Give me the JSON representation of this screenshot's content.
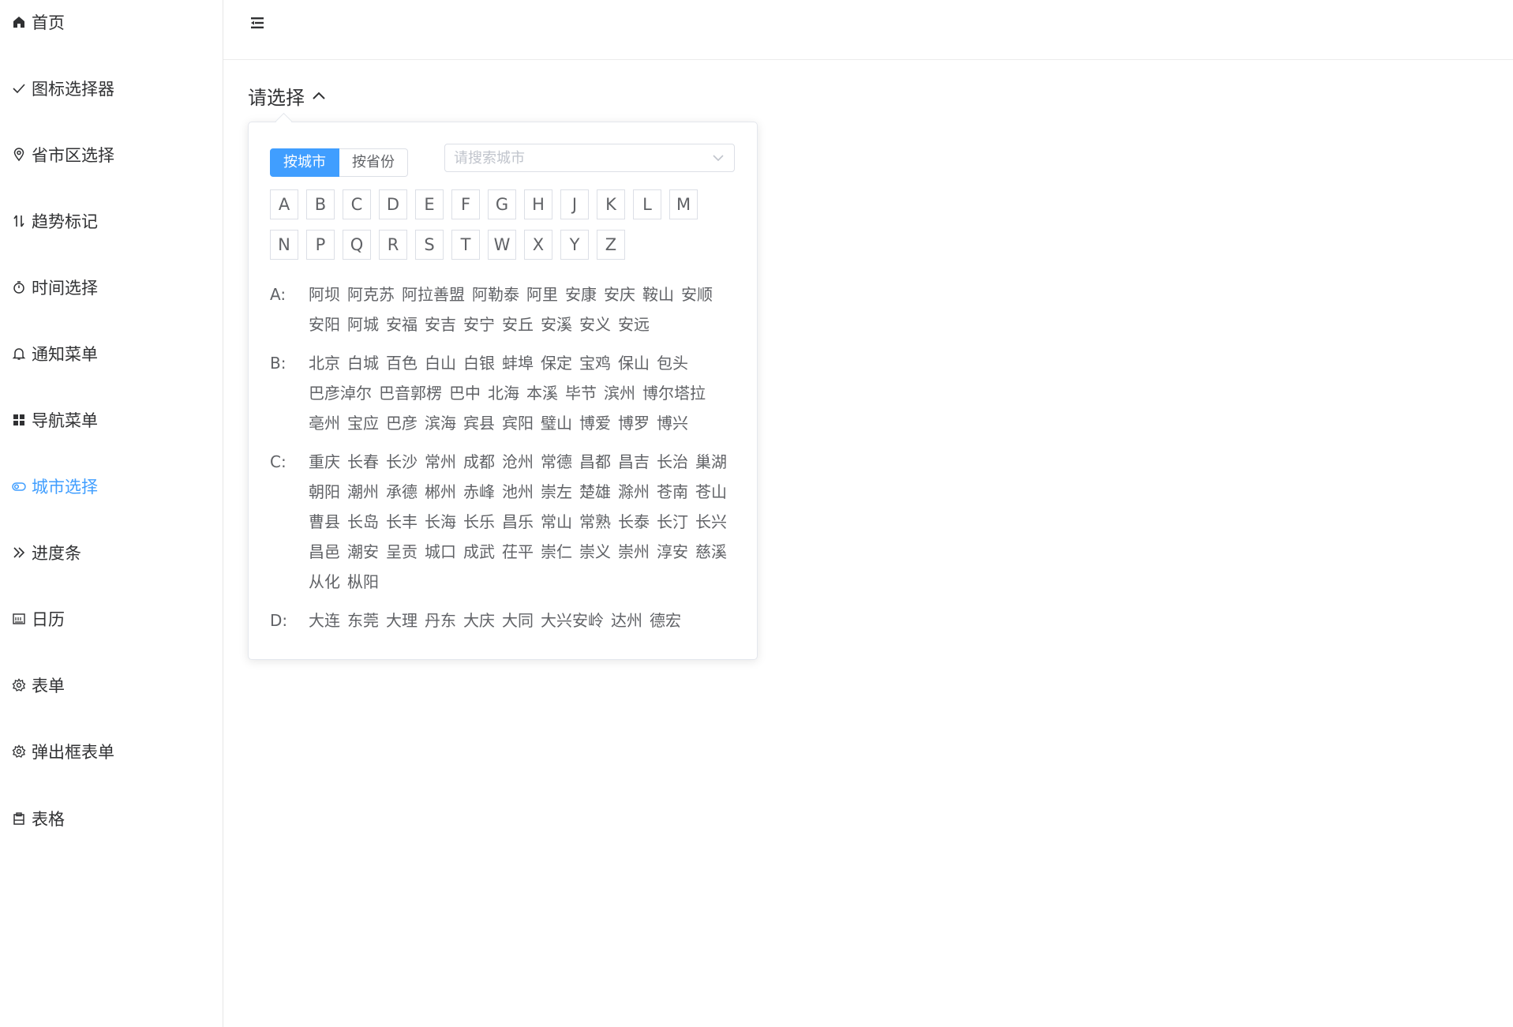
{
  "sidebar": {
    "items": [
      {
        "label": "首页",
        "icon": "home-icon",
        "active": false
      },
      {
        "label": "图标选择器",
        "icon": "check-icon",
        "active": false
      },
      {
        "label": "省市区选择",
        "icon": "location-icon",
        "active": false
      },
      {
        "label": "趋势标记",
        "icon": "sort-icon",
        "active": false
      },
      {
        "label": "时间选择",
        "icon": "timer-icon",
        "active": false
      },
      {
        "label": "通知菜单",
        "icon": "bell-icon",
        "active": false
      },
      {
        "label": "导航菜单",
        "icon": "grid-icon",
        "active": false
      },
      {
        "label": "城市选择",
        "icon": "toggle-icon",
        "active": true
      },
      {
        "label": "进度条",
        "icon": "double-arrow-icon",
        "active": false
      },
      {
        "label": "日历",
        "icon": "calendar-icon",
        "active": false
      },
      {
        "label": "表单",
        "icon": "gear-icon",
        "active": false
      },
      {
        "label": "弹出框表单",
        "icon": "gear-icon",
        "active": false
      },
      {
        "label": "表格",
        "icon": "clipboard-icon",
        "active": false
      }
    ]
  },
  "header": {
    "collapse_icon": "fold-icon"
  },
  "selector": {
    "label": "请选择",
    "icon": "chevron-up-icon"
  },
  "popover": {
    "tabs": [
      {
        "label": "按城市",
        "active": true
      },
      {
        "label": "按省份",
        "active": false
      }
    ],
    "search": {
      "placeholder": "请搜索城市",
      "value": ""
    },
    "letters": [
      [
        "A",
        "B",
        "C",
        "D",
        "E",
        "F",
        "G",
        "H",
        "J",
        "K",
        "L",
        "M"
      ],
      [
        "N",
        "P",
        "Q",
        "R",
        "S",
        "T",
        "W",
        "X",
        "Y",
        "Z"
      ]
    ],
    "groups": [
      {
        "key": "A:",
        "cities": [
          "阿坝",
          "阿克苏",
          "阿拉善盟",
          "阿勒泰",
          "阿里",
          "安康",
          "安庆",
          "鞍山",
          "安顺",
          "安阳",
          "阿城",
          "安福",
          "安吉",
          "安宁",
          "安丘",
          "安溪",
          "安义",
          "安远"
        ]
      },
      {
        "key": "B:",
        "cities": [
          "北京",
          "白城",
          "百色",
          "白山",
          "白银",
          "蚌埠",
          "保定",
          "宝鸡",
          "保山",
          "包头",
          "巴彦淖尔",
          "巴音郭楞",
          "巴中",
          "北海",
          "本溪",
          "毕节",
          "滨州",
          "博尔塔拉",
          "亳州",
          "宝应",
          "巴彦",
          "滨海",
          "宾县",
          "宾阳",
          "璧山",
          "博爱",
          "博罗",
          "博兴"
        ]
      },
      {
        "key": "C:",
        "cities": [
          "重庆",
          "长春",
          "长沙",
          "常州",
          "成都",
          "沧州",
          "常德",
          "昌都",
          "昌吉",
          "长治",
          "巢湖",
          "朝阳",
          "潮州",
          "承德",
          "郴州",
          "赤峰",
          "池州",
          "崇左",
          "楚雄",
          "滁州",
          "苍南",
          "苍山",
          "曹县",
          "长岛",
          "长丰",
          "长海",
          "长乐",
          "昌乐",
          "常山",
          "常熟",
          "长泰",
          "长汀",
          "长兴",
          "昌邑",
          "潮安",
          "呈贡",
          "城口",
          "成武",
          "茌平",
          "崇仁",
          "崇义",
          "崇州",
          "淳安",
          "慈溪",
          "从化",
          "枞阳"
        ]
      },
      {
        "key": "D:",
        "cities": [
          "大连",
          "东莞",
          "大理",
          "丹东",
          "大庆",
          "大同",
          "大兴安岭",
          "达州",
          "德宏"
        ]
      }
    ]
  }
}
